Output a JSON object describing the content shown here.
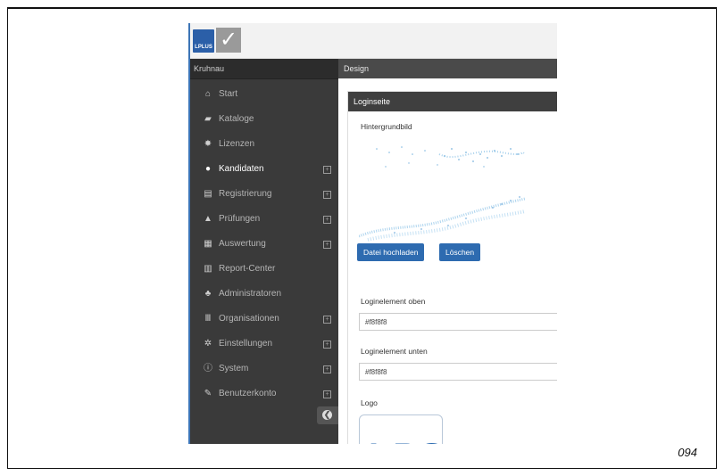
{
  "app": {
    "logo_text": "LPLUS",
    "org_name": "Kruhnau",
    "section_title": "Design"
  },
  "sidebar": {
    "items": [
      {
        "label": "Start",
        "icon": "home-icon",
        "expandable": false,
        "active": false
      },
      {
        "label": "Kataloge",
        "icon": "book-icon",
        "expandable": false,
        "active": false
      },
      {
        "label": "Lizenzen",
        "icon": "certificate-icon",
        "expandable": false,
        "active": false
      },
      {
        "label": "Kandidaten",
        "icon": "user-icon",
        "expandable": true,
        "active": true
      },
      {
        "label": "Registrierung",
        "icon": "id-card-icon",
        "expandable": true,
        "active": false
      },
      {
        "label": "Prüfungen",
        "icon": "graduation-cap-icon",
        "expandable": true,
        "active": false
      },
      {
        "label": "Auswertung",
        "icon": "table-icon",
        "expandable": true,
        "active": false
      },
      {
        "label": "Report-Center",
        "icon": "bar-chart-icon",
        "expandable": false,
        "active": false
      },
      {
        "label": "Administratoren",
        "icon": "users-icon",
        "expandable": false,
        "active": false
      },
      {
        "label": "Organisationen",
        "icon": "institution-icon",
        "expandable": true,
        "active": false
      },
      {
        "label": "Einstellungen",
        "icon": "cogs-icon",
        "expandable": true,
        "active": false
      },
      {
        "label": "System",
        "icon": "info-icon",
        "expandable": true,
        "active": false
      },
      {
        "label": "Benutzerkonto",
        "icon": "wrench-icon",
        "expandable": true,
        "active": false
      }
    ],
    "expand_glyph": "⊞",
    "collapse_glyph": "❮"
  },
  "panel": {
    "title": "Loginseite",
    "bg_label": "Hintergrundbild",
    "upload_button": "Datei hochladen",
    "delete_button": "Löschen",
    "top_label": "Loginelement oben",
    "top_value": "#f8f8f8",
    "bottom_label": "Loginelement unten",
    "bottom_value": "#f8f8f8",
    "logo_label": "Logo",
    "logo_preview_text": "LPS"
  },
  "page_number": "094",
  "colors": {
    "accent": "#2e6bb0",
    "sidebar_bg": "#3a3a3a",
    "header_bg": "#4a4a4a"
  }
}
